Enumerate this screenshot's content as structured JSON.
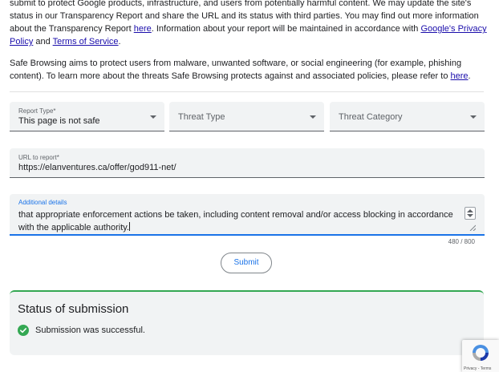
{
  "intro": {
    "line1": "submit to protect Google products, infrastructure, and users from potentially harmful content. We may update the site's",
    "line2": "status in our Transparency Report and share the URL and its status with third parties. You may find out more information",
    "line3_a": "about the Transparency Report ",
    "line3_link": "here",
    "line3_b": ". Information about your report will be maintained in accordance with ",
    "privacy_link": "Google's Privacy Policy",
    "and": " and ",
    "terms_link": "Terms of Service",
    "end": "."
  },
  "safe_browsing": {
    "text": "Safe Browsing aims to protect users from malware, unwanted software, or social engineering (for example, phishing content). To learn more about the threats Safe Browsing protects against and associated policies, please refer to ",
    "link": "here",
    "end": "."
  },
  "form": {
    "report_type": {
      "label": "Report Type*",
      "value": "This page is not safe"
    },
    "threat_type": {
      "placeholder": "Threat Type"
    },
    "threat_category": {
      "placeholder": "Threat Category"
    },
    "url": {
      "label": "URL to report*",
      "value": "https://elanventures.ca/offer/god911-net/"
    },
    "details": {
      "label": "Additional details",
      "value": "that appropriate enforcement actions be taken, including content removal and/or access blocking in accordance with the applicable authority.",
      "counter": "480 / 800"
    },
    "submit_label": "Submit"
  },
  "status": {
    "title": "Status of submission",
    "message": "Submission was successful."
  },
  "recaptcha": {
    "links": "Privacy - Terms"
  },
  "colors": {
    "link": "#1a0dab",
    "accent": "#1a73e8",
    "success": "#34a853"
  }
}
